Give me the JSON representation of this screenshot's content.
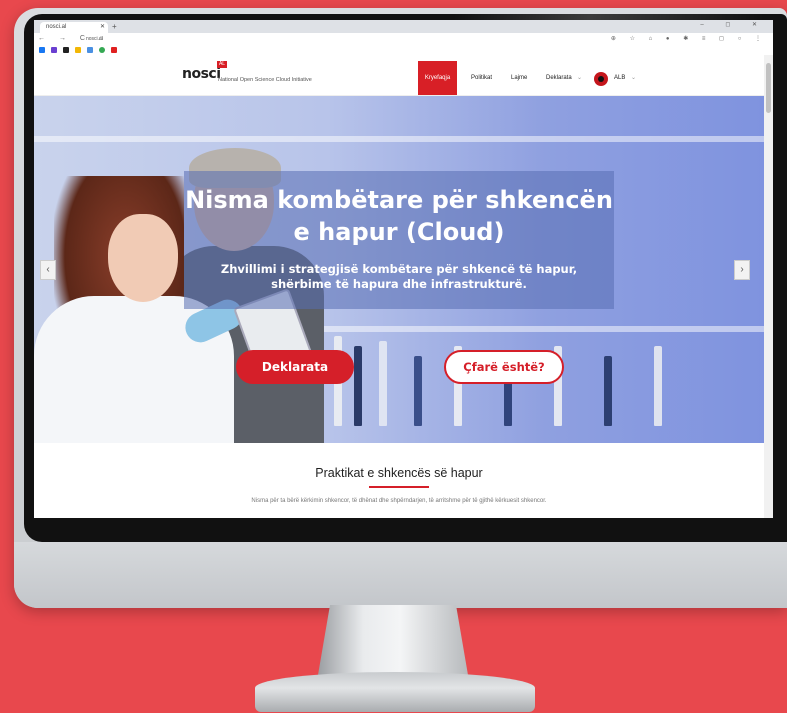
{
  "browser": {
    "tab_title": "nosci.al",
    "url": "nosci.al",
    "nav": "← → C ⌂",
    "extensions": "⊕ ☆ ⌂ ● ✱ ≡ ◻ ○ ⋮",
    "window_controls": "– ◻ ✕"
  },
  "site": {
    "logo_word": "nosci",
    "logo_badge": "AL",
    "logo_tagline": "National Open Science Cloud Initiative",
    "menu": {
      "active": "Kryefaqja",
      "items": [
        "Politikat",
        "Lajme",
        "Deklarata"
      ],
      "language": "ALB"
    }
  },
  "hero": {
    "title": "Nisma kombëtare për shkencën e hapur (Cloud)",
    "subtitle": "Zhvillimi i strategjisë kombëtare për shkencë të hapur, shërbime të hapura dhe infrastrukturë.",
    "button_primary": "Deklarata",
    "button_secondary": "Çfarë është?",
    "prev_arrow": "‹",
    "next_arrow": "›"
  },
  "section": {
    "title": "Praktikat e shkencës së hapur",
    "text": "Nisma për ta bërë kërkimin shkencor, të dhënat dhe shpërndarjen, të arritshme për të gjithë kërkuesit shkencor."
  },
  "colors": {
    "accent": "#d51f29",
    "background": "#e8484d",
    "hero_blue": "#8fa0e0"
  }
}
